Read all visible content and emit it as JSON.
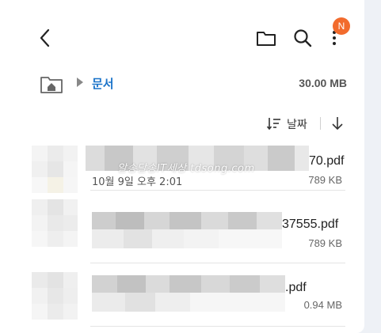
{
  "header": {
    "back_icon": "chevron-left-icon",
    "folder_icon": "folder-icon",
    "search_icon": "search-icon",
    "more_icon": "more-vertical-icon",
    "badge_text": "N",
    "badge_color": "#f26b2d"
  },
  "path": {
    "home_icon": "home-folder-icon",
    "current": "문서",
    "storage_used": "30.00 MB",
    "accent_color": "#1a73c9"
  },
  "sort": {
    "label": "날짜",
    "sort_icon": "sort-icon",
    "direction_icon": "arrow-down-icon"
  },
  "files": [
    {
      "name_visible": "70.pdf",
      "date": "10월 9일 오후 2:01",
      "size": "789 KB"
    },
    {
      "name_visible": "37555.pdf",
      "date": "",
      "size": "789 KB"
    },
    {
      "name_visible": ".pdf",
      "date": "",
      "size": "0.94 MB"
    }
  ],
  "watermark": "알송달송IT세상 tdsong.com"
}
